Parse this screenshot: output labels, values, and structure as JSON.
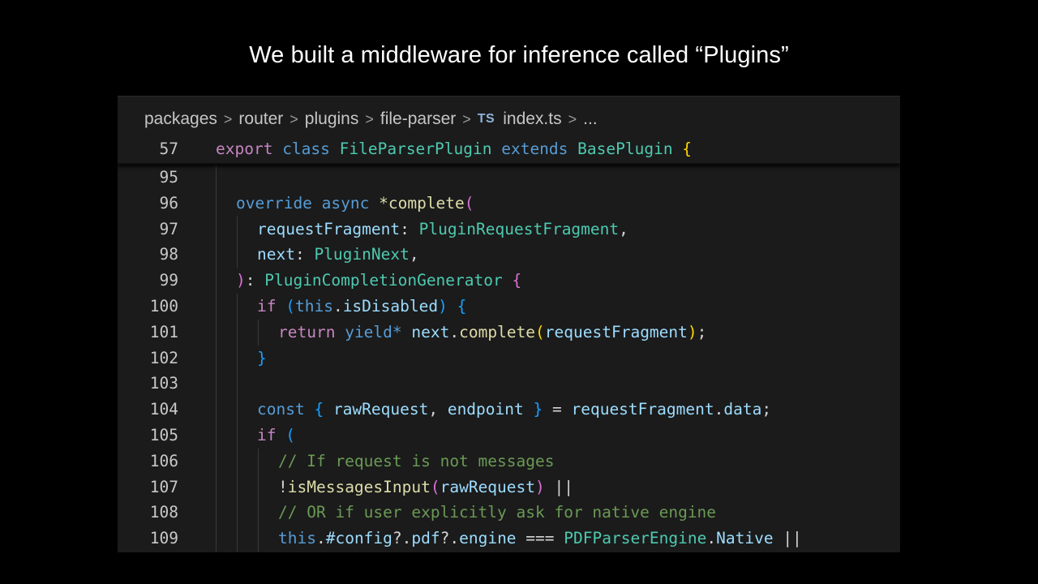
{
  "slide": {
    "title": "We built a middleware for inference called “Plugins”"
  },
  "breadcrumb": {
    "items": [
      "packages",
      "router",
      "plugins",
      "file-parser"
    ],
    "file_badge": "TS",
    "file_name": "index.ts",
    "ellipsis": "...",
    "separator": ">"
  },
  "sticky_line": {
    "number": "57",
    "tokens": [
      "export",
      " class ",
      "FileParserPlugin",
      " extends ",
      "BasePlugin",
      " {"
    ]
  },
  "code_lines": [
    {
      "number": "95"
    },
    {
      "number": "96",
      "tokens": [
        "override",
        " async ",
        "*complete",
        "("
      ]
    },
    {
      "number": "97",
      "tokens": [
        "requestFragment",
        ": ",
        "PluginRequestFragment",
        ","
      ]
    },
    {
      "number": "98",
      "tokens": [
        "next",
        ": ",
        "PluginNext",
        ","
      ]
    },
    {
      "number": "99",
      "tokens": [
        ")",
        ": ",
        "PluginCompletionGenerator",
        " {"
      ]
    },
    {
      "number": "100",
      "tokens": [
        "if",
        " (",
        "this",
        ".",
        "isDisabled",
        ")",
        " {"
      ]
    },
    {
      "number": "101",
      "tokens": [
        "return",
        " ",
        "yield*",
        " ",
        "next",
        ".",
        "complete",
        "(",
        "requestFragment",
        ")",
        ";"
      ]
    },
    {
      "number": "102",
      "tokens": [
        "}"
      ]
    },
    {
      "number": "103"
    },
    {
      "number": "104",
      "tokens": [
        "const",
        " ",
        "{",
        " rawRequest",
        ", ",
        "endpoint",
        " ",
        "}",
        " = ",
        "requestFragment",
        ".",
        "data",
        ";"
      ]
    },
    {
      "number": "105",
      "tokens": [
        "if",
        " ("
      ]
    },
    {
      "number": "106",
      "tokens": [
        "// If request is not messages"
      ]
    },
    {
      "number": "107",
      "tokens": [
        "!",
        "isMessagesInput",
        "(",
        "rawRequest",
        ")",
        " ||"
      ]
    },
    {
      "number": "108",
      "tokens": [
        "// OR if user explicitly ask for native engine"
      ]
    },
    {
      "number": "109",
      "tokens": [
        "this",
        ".",
        "#config",
        "?.",
        "pdf",
        "?.",
        "engine",
        " === ",
        "PDFParserEngine",
        ".",
        "Native",
        " ||"
      ]
    }
  ],
  "colors": {
    "keyword": "#c586c0",
    "storage": "#569cd6",
    "type": "#4ec9b0",
    "function": "#dcdcaa",
    "variable": "#9cdcfe",
    "comment": "#6a9955",
    "bracket_gold": "#ffd700",
    "bracket_pink": "#da70d6",
    "bracket_blue": "#179fff"
  }
}
